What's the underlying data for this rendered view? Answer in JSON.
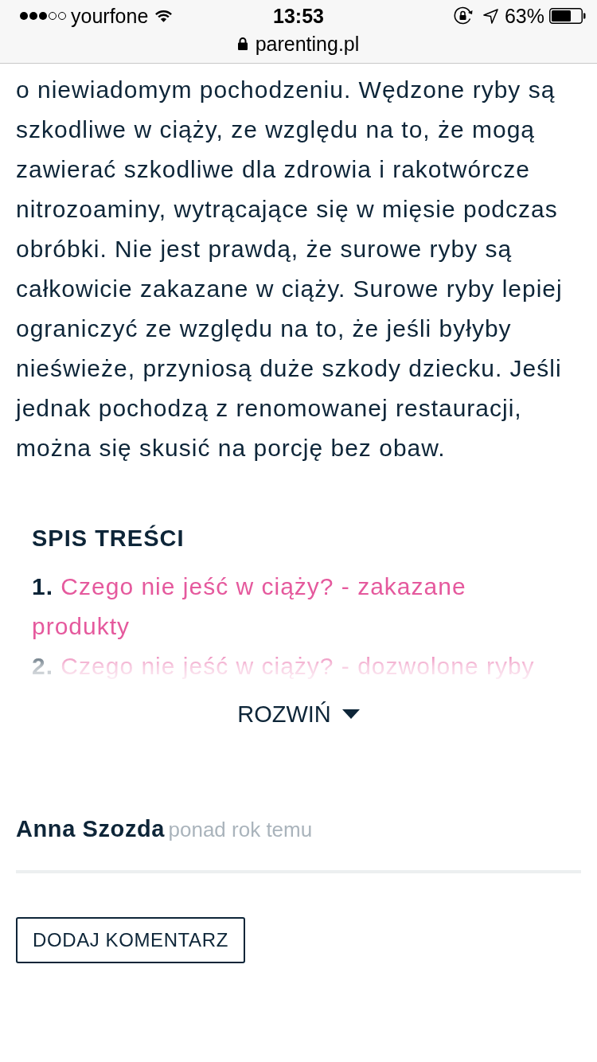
{
  "status_bar": {
    "carrier": "yourfone",
    "time": "13:53",
    "battery": "63%"
  },
  "address_bar": {
    "url": "parenting.pl"
  },
  "article": {
    "paragraph": "o niewiadomym pochodzeniu. Wędzone ryby są szkodliwe w ciąży, ze względu na to, że mogą zawierać szkodliwe dla zdrowia i rakotwórcze nitrozoaminy, wytrącające się w mięsie podczas obróbki. Nie jest prawdą, że surowe ryby są całkowicie zakazane w ciąży. Surowe ryby lepiej ograniczyć ze względu na to, że jeśli byłyby nieświeże, przyniosą duże szkody dziecku. Jeśli jednak pochodzą z renomowanej restauracji, można się skusić na porcję bez obaw."
  },
  "toc": {
    "title": "SPIS TREŚCI",
    "expanded": false,
    "items": [
      {
        "number": "1.",
        "title": "Czego nie jeść w ciąży? - zakazane produkty"
      },
      {
        "number": "2.",
        "title": "Czego nie jeść w ciąży? - dozwolone ryby"
      }
    ],
    "toggle": "ROZWIŃ"
  },
  "author": {
    "name": "Anna Szozda",
    "date": "ponad rok temu"
  },
  "comment_button": "DODAJ KOMENTARZ"
}
